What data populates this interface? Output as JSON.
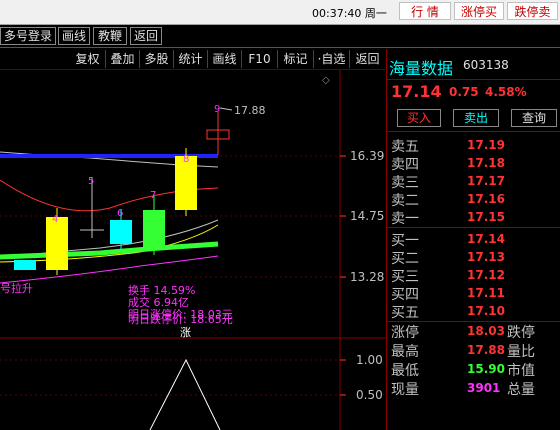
{
  "topbar": {
    "clock": "00:37:40 周一",
    "buttons": [
      "行 情",
      "涨停买",
      "跌停卖"
    ]
  },
  "menubar": {
    "items": [
      "多号登录",
      "画线",
      "教鞭",
      "返回"
    ]
  },
  "toolbar": {
    "items": [
      "复权",
      "叠加",
      "多股",
      "统计",
      "画线",
      "F10",
      "标记",
      "·自选",
      "返回"
    ]
  },
  "chart": {
    "high_label": "17.88",
    "axis_labels": [
      "16.39",
      "14.75",
      "13.28"
    ],
    "lower_axis_labels": [
      "1.00",
      "0.50"
    ],
    "candle_numbers": [
      "4",
      "5",
      "6",
      "7",
      "8",
      "9"
    ],
    "left_label": "号拉升",
    "overlay_lines": [
      "换手 14.59%",
      "成交 6.94亿",
      "明日涨停价: 18.03元",
      "明日跌停价: 18.65元"
    ],
    "marker": "涨"
  },
  "panel": {
    "name": "海量数据",
    "code": "603138",
    "price": "17.14",
    "change": "0.75",
    "change_pct": "4.58%",
    "actions": [
      "买入",
      "卖出",
      "查询"
    ],
    "asks": [
      {
        "label": "卖五",
        "price": "17.19"
      },
      {
        "label": "卖四",
        "price": "17.18"
      },
      {
        "label": "卖三",
        "price": "17.17"
      },
      {
        "label": "卖二",
        "price": "17.16"
      },
      {
        "label": "卖一",
        "price": "17.15"
      }
    ],
    "bids": [
      {
        "label": "买一",
        "price": "17.14"
      },
      {
        "label": "买二",
        "price": "17.13"
      },
      {
        "label": "买三",
        "price": "17.12"
      },
      {
        "label": "买四",
        "price": "17.11"
      },
      {
        "label": "买五",
        "price": "17.10"
      }
    ],
    "stats": [
      {
        "label": "涨停",
        "value": "18.03",
        "label2": "跌停",
        "color": "#ff3333"
      },
      {
        "label": "最高",
        "value": "17.88",
        "label2": "量比",
        "color": "#ff3333"
      },
      {
        "label": "最低",
        "value": "15.90",
        "label2": "市值",
        "color": "#33ff33"
      },
      {
        "label": "现量",
        "value": "3901",
        "label2": "总量",
        "color": "#ff33ff"
      }
    ]
  },
  "colors": {
    "up": "#ff3333",
    "down": "#00ffff",
    "accent": "#ffff00"
  }
}
